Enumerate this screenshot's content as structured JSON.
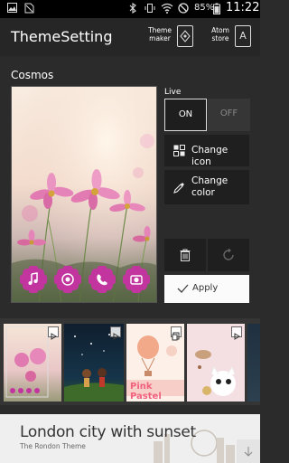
{
  "status_bar": {
    "battery_percent": "85%",
    "time": "11:22",
    "icons": [
      "image-icon",
      "no-sim-icon",
      "bluetooth-icon",
      "vibrate-icon",
      "wifi-icon",
      "do-not-disturb-icon",
      "battery-icon"
    ]
  },
  "app_bar": {
    "title": "ThemeSetting",
    "theme_maker_line1": "Theme",
    "theme_maker_line2": "maker",
    "atom_store_line1": "Atom",
    "atom_store_line2": "store",
    "atom_store_glyph": "A"
  },
  "theme": {
    "name": "Cosmos"
  },
  "live": {
    "label": "Live",
    "on_label": "ON",
    "off_label": "OFF",
    "selected": "ON"
  },
  "actions": {
    "change_icon": "Change icon",
    "change_color_line1": "Change",
    "change_color_line2": "color",
    "apply": "Apply"
  },
  "dock_icons": [
    "music-icon",
    "camera-icon",
    "phone-icon",
    "camera-lens-icon"
  ],
  "thumbnails": [
    {
      "name": "cosmos-thumb",
      "selected": true
    },
    {
      "name": "night-sky-thumb",
      "selected": false
    },
    {
      "name": "pink-pastel-thumb",
      "label": "Pink Pastel",
      "selected": false
    },
    {
      "name": "cat-cafe-thumb",
      "selected": false
    },
    {
      "name": "partial-thumb",
      "selected": false
    }
  ],
  "ad": {
    "title": "London city with sunset",
    "subtitle": "The Rondon Theme"
  },
  "colors": {
    "background": "#2b2b2b",
    "appbar": "#262626",
    "button_bg": "#1f1f1f",
    "apply_bg": "#fbfbfb",
    "dock_pink": "#c2359f"
  }
}
